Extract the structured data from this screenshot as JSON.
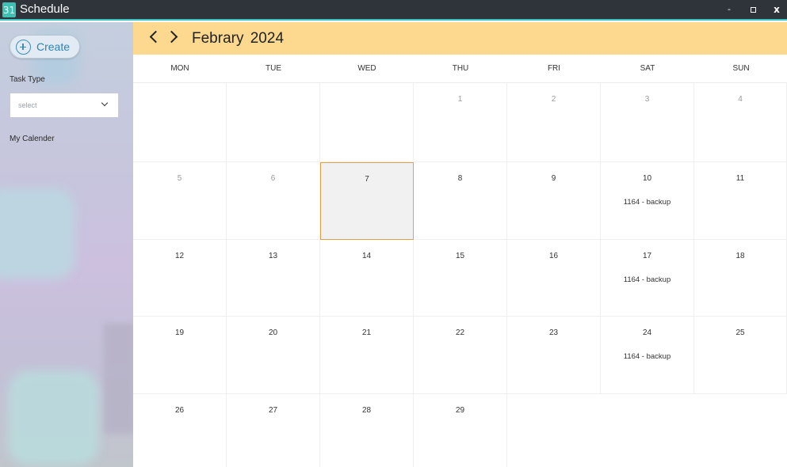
{
  "window": {
    "app_icon_text": "31",
    "title": "Schedule",
    "minimize_label": "-",
    "close_label": "x"
  },
  "sidebar": {
    "create_label": "Create",
    "task_type_label": "Task Type",
    "task_type_select_value": "select",
    "my_calendar_label": "My Calender"
  },
  "calendar": {
    "month_title": "Febrary 2024",
    "weekdays": [
      "MON",
      "TUE",
      "WED",
      "THU",
      "FRI",
      "SAT",
      "SUN"
    ],
    "weeks": [
      [
        "",
        "",
        "",
        "1",
        "2",
        "3",
        "4"
      ],
      [
        "5",
        "6",
        "7",
        "8",
        "9",
        "10",
        "11"
      ],
      [
        "12",
        "13",
        "14",
        "15",
        "16",
        "17",
        "18"
      ],
      [
        "19",
        "20",
        "21",
        "22",
        "23",
        "24",
        "25"
      ],
      [
        "26",
        "27",
        "28",
        "29",
        "",
        "",
        ""
      ]
    ],
    "selected_day": "7",
    "events": {
      "10": "1164 - backup",
      "17": "1164 - backup",
      "24": "1164 - backup"
    }
  }
}
